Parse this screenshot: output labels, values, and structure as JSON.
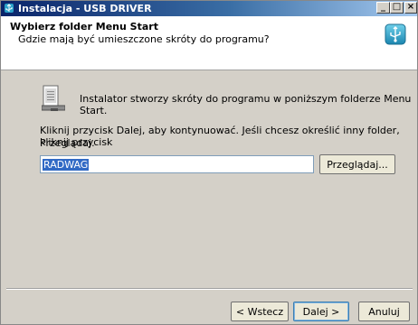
{
  "window": {
    "title": "Instalacja - USB DRIVER",
    "minimize": "_",
    "maximize": "□",
    "close": "×"
  },
  "header": {
    "title": "Wybierz folder Menu Start",
    "subtitle": "Gdzie mają być umieszczone skróty do programu?",
    "icon": "usb-setup-icon"
  },
  "main": {
    "intro": "Instalator stworzy skróty do programu w poniższym folderze Menu Start.",
    "instructions_line1": "Kliknij przycisk Dalej, aby kontynuować. Jeśli chcesz określić inny folder, kliknij przycisk",
    "instructions_line2": "Przeglądaj.",
    "folder_value": "RADWAG",
    "browse_label": "Przeglądaj..."
  },
  "footer": {
    "back_label": "< Wstecz",
    "next_label": "Dalej >",
    "cancel_label": "Anuluj"
  },
  "colors": {
    "titlebar_start": "#0a246a",
    "selection": "#316ac5",
    "dialog_bg": "#d4d0c8"
  }
}
